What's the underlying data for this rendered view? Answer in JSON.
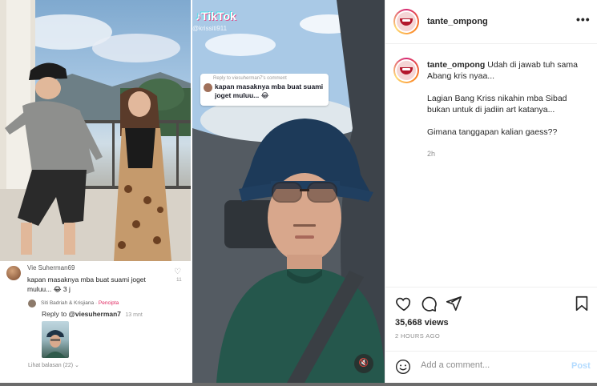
{
  "post": {
    "username": "tante_ompong",
    "more_icon": "more-horizontal-icon",
    "caption_user": "tante_ompong",
    "caption_lines": [
      "Udah di jawab tuh sama Abang kris nyaa...",
      "Lagian Bang Kriss nikahin mba Sibad bukan untuk di jadiin art katanya...",
      "Gimana tanggapan kalian gaess??"
    ],
    "caption_time": "2h",
    "views": "35,668 views",
    "posted_ago": "2 HOURS AGO",
    "add_comment_placeholder": "Add a comment...",
    "post_label": "Post"
  },
  "tiktok_left": {
    "commenter": "Vie Suherman69",
    "comment": "kapan masaknya mba buat suami joget muluu... 😂 3 j",
    "comment_likes": "11",
    "reply_author": "Siti Badriah & Krisjiana",
    "reply_badge": "Pencipta",
    "reply_to_prefix": "Reply to",
    "reply_to_user": "@viesuherman7",
    "reply_time": "13 mnt",
    "view_replies": "Lihat balasan (22)"
  },
  "tiktok_right": {
    "logo": "TikTok",
    "handle": "@krissiti911",
    "sticker_header": "Reply to viesuherman7's comment",
    "sticker_text": "kapan masaknya mba buat suami joget muluu... 😂"
  },
  "colors": {
    "accent_link": "#0095f6",
    "post_disabled": "#b3dbff",
    "creator_tag": "#e0245e",
    "border": "#efefef"
  }
}
